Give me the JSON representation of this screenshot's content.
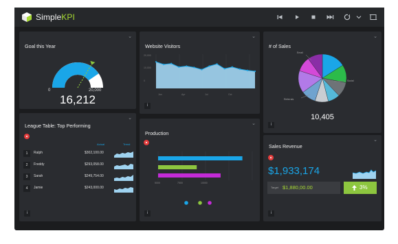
{
  "app": {
    "brand_main": "Simple",
    "brand_accent": "KPI"
  },
  "toolbar": {
    "icons": [
      "skip-back-icon",
      "play-icon",
      "stop-icon",
      "skip-forward-icon",
      "refresh-icon",
      "chevron-down-icon",
      "fullscreen-icon"
    ]
  },
  "goal": {
    "title": "Goal this Year",
    "min_label": "0",
    "max_label": "20,000",
    "value": "16,212",
    "gauge_fraction": 0.81
  },
  "visitors": {
    "title": "Website Visitors",
    "y_ticks": [
      "20,000",
      "10,000",
      "0"
    ],
    "x_ticks": [
      "Jan",
      "Apr",
      "Jul",
      "Oct"
    ],
    "chart_data": {
      "type": "area",
      "values": [
        62,
        56,
        58,
        50,
        52,
        49,
        44,
        52,
        57,
        46,
        50,
        45,
        42,
        40
      ]
    }
  },
  "sales": {
    "title": "# of Sales",
    "value": "10,405",
    "slice_labels": [
      "Email",
      "Social",
      "Referrals"
    ],
    "chart_data": {
      "type": "pie",
      "values": [
        16,
        12,
        10,
        8,
        9,
        10,
        15,
        10,
        10
      ],
      "colors": [
        "#1aa6e8",
        "#2cbb4a",
        "#6e7377",
        "#55b9d9",
        "#c8cdd2",
        "#6fa3cf",
        "#b27ae8",
        "#d449d8",
        "#8a2ea6"
      ]
    }
  },
  "league": {
    "title": "League Table: Top Performing",
    "col_actual": "Actual",
    "col_trend": "Trend",
    "rows": [
      {
        "rank": "1",
        "name": "Ralph",
        "value": "$302,100.00"
      },
      {
        "rank": "2",
        "name": "Freddy",
        "value": "$293,058.00"
      },
      {
        "rank": "3",
        "name": "Sarah",
        "value": "$249,754.00"
      },
      {
        "rank": "4",
        "name": "Jamie",
        "value": "$243,000.00"
      }
    ]
  },
  "production": {
    "title": "Production",
    "x_ticks": [
      "5000",
      "7500",
      "10000"
    ],
    "chart_data": {
      "type": "bar",
      "values": [
        10500,
        5900,
        8300
      ],
      "xlim": [
        2000,
        11500
      ],
      "colors": [
        "#1aa6e8",
        "#8dc63f",
        "#c42bd8"
      ]
    }
  },
  "revenue": {
    "title": "Sales Revenue",
    "value": "$1,933,174",
    "target_label": "Target",
    "target_value": "$1,880,00.00",
    "delta": "3%"
  },
  "colors": {
    "accent": "#1aa6e8",
    "green": "#8dc63f",
    "brand_green": "#a6d833"
  }
}
